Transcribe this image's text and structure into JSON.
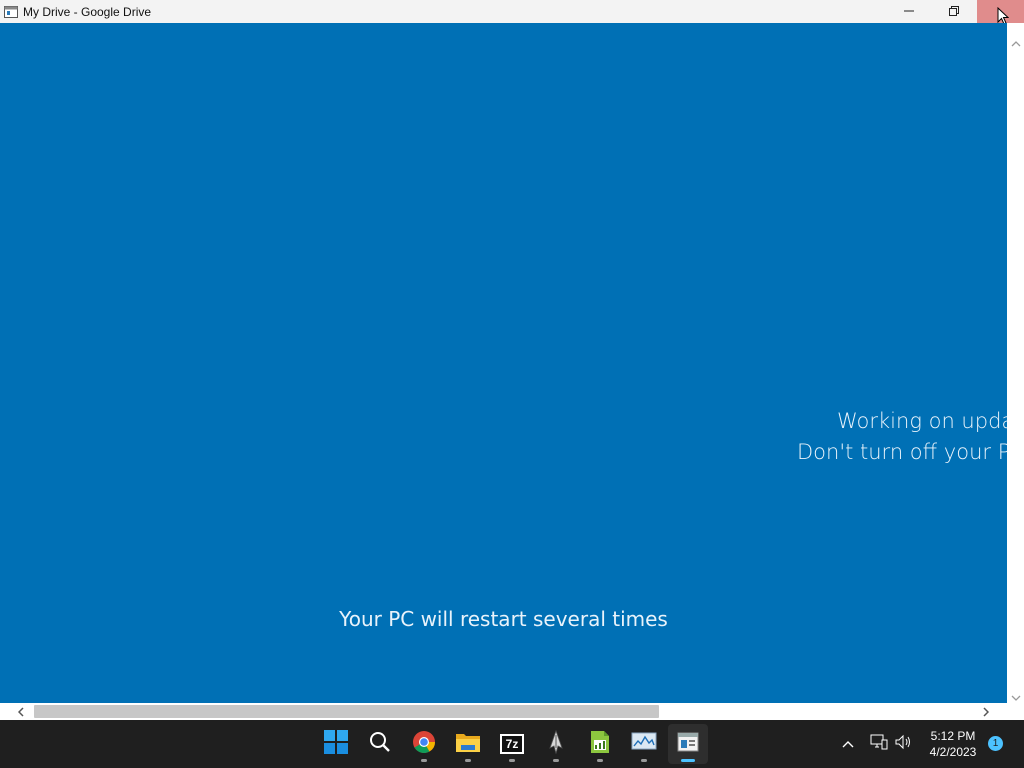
{
  "window": {
    "title": "My Drive - Google Drive",
    "icon": "app-window-icon",
    "controls": [
      "minimize-icon",
      "restore-icon",
      "close-icon"
    ]
  },
  "update_screen": {
    "line1": "Working on upda",
    "line2": "Don't turn off your PC",
    "footer": "Your PC will restart several times",
    "background": "#0070b5",
    "text_color": "#e9f3fb"
  },
  "taskbar": {
    "items": [
      {
        "name": "start-button",
        "icon": "windows-logo-icon"
      },
      {
        "name": "search-button",
        "icon": "search-icon"
      },
      {
        "name": "chrome-button",
        "icon": "chrome-icon"
      },
      {
        "name": "file-explorer-button",
        "icon": "folder-icon"
      },
      {
        "name": "7zip-button",
        "icon": "7zip-icon",
        "label": "7z"
      },
      {
        "name": "inkscape-button",
        "icon": "inkscape-icon"
      },
      {
        "name": "spreadsheet-button",
        "icon": "spreadsheet-icon"
      },
      {
        "name": "resource-monitor-button",
        "icon": "monitor-chart-icon"
      },
      {
        "name": "remote-desktop-button",
        "icon": "window-app-icon"
      }
    ],
    "clock": {
      "time": "5:12 PM",
      "date": "4/2/2023"
    },
    "notification_count": "1"
  }
}
